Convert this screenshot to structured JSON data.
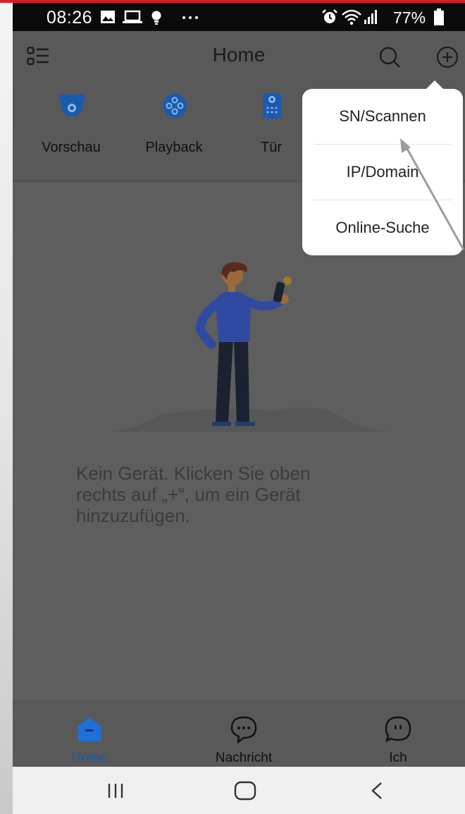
{
  "status_bar": {
    "time": "08:26",
    "battery": "77%",
    "icons": [
      "image-icon",
      "laptop-icon",
      "bulb-icon",
      "more-dots-icon",
      "alarm-icon",
      "wifi-icon",
      "signal-icon",
      "battery-icon"
    ]
  },
  "app_bar": {
    "title": "Home",
    "icons": [
      "menu-list-icon",
      "search-icon",
      "add-circle-icon"
    ]
  },
  "shortcuts": [
    {
      "label": "Vorschau",
      "icon": "dome-camera-icon"
    },
    {
      "label": "Playback",
      "icon": "film-reel-icon"
    },
    {
      "label": "Tür",
      "icon": "door-intercom-icon"
    }
  ],
  "popup_menu": {
    "items": [
      {
        "label": "SN/Scannen"
      },
      {
        "label": "IP/Domain"
      },
      {
        "label": "Online-Suche"
      }
    ]
  },
  "empty_state": {
    "message": "Kein Gerät. Klicken Sie oben\nrechts auf „+“, um ein Gerät\nhinzuzufügen.",
    "illustration": "person-holding-phone-illustration"
  },
  "bottom_nav": {
    "items": [
      {
        "label": "Home",
        "icon": "home-icon",
        "active": true
      },
      {
        "label": "Nachricht",
        "icon": "chat-bubble-icon",
        "active": false
      },
      {
        "label": "Ich",
        "icon": "smiley-bubble-icon",
        "active": false
      }
    ]
  },
  "system_nav": {
    "icons": [
      "recents-icon",
      "home-outline-icon",
      "back-chevron-icon"
    ]
  },
  "colors": {
    "accent": "#1f6fd9",
    "overlay_background": "#5e5e5e",
    "status_bar": "#0b0b0b",
    "border_red": "#d81e2b"
  }
}
